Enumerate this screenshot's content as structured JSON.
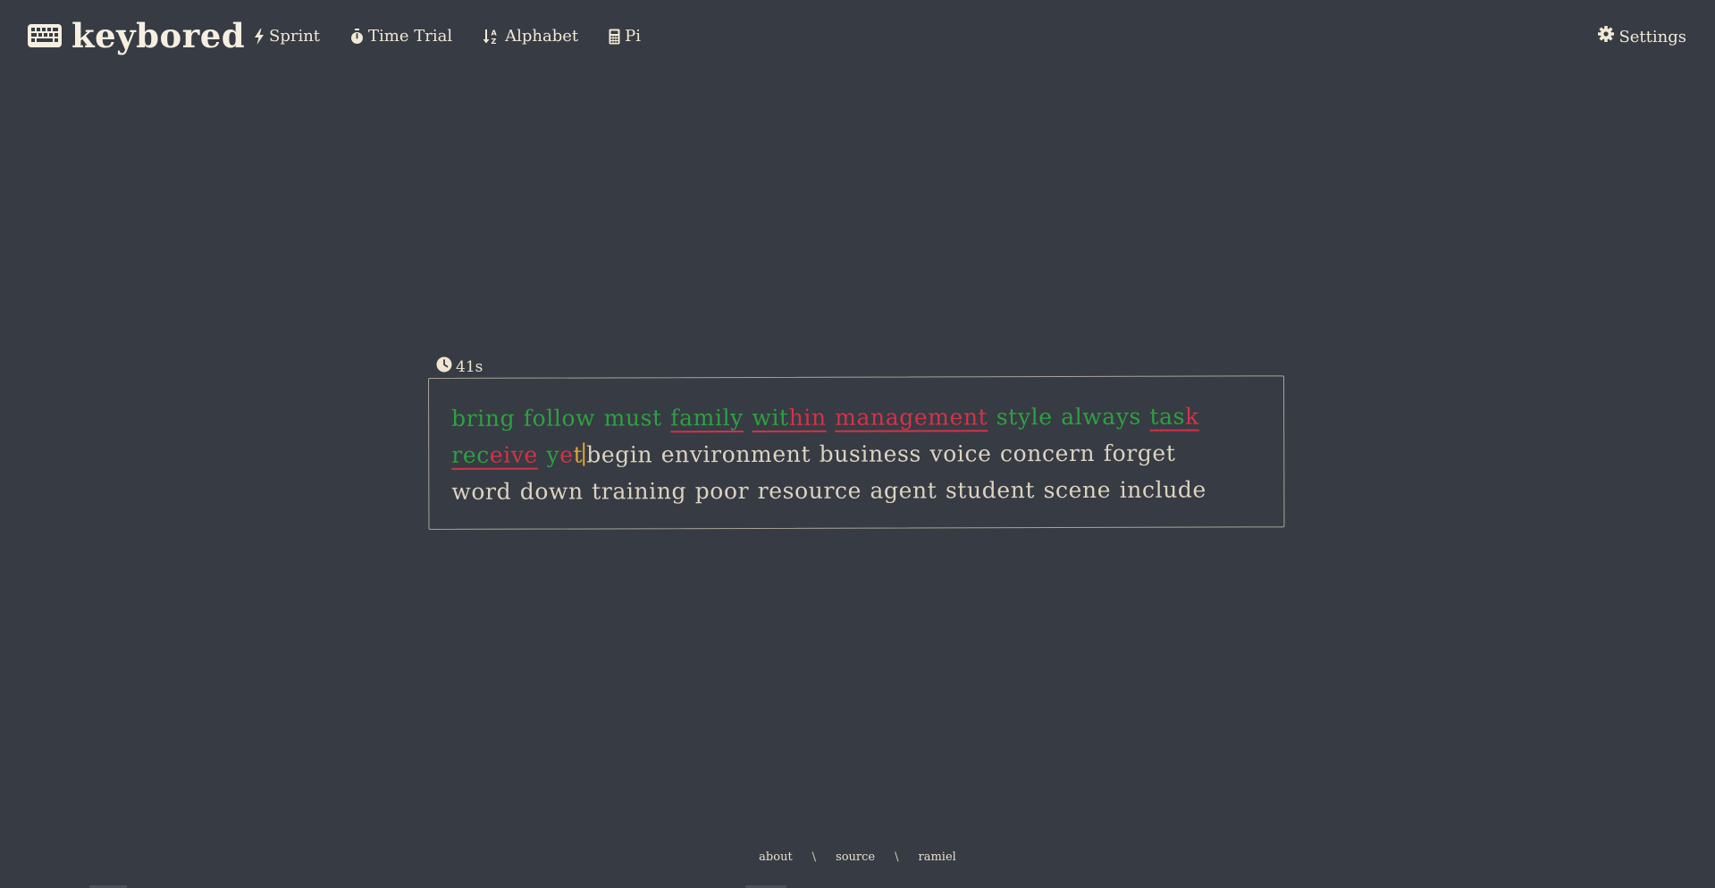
{
  "brand": {
    "name": "keybored",
    "icon": "keyboard-icon"
  },
  "nav": {
    "items": [
      {
        "label": "Sprint",
        "icon": "bolt-icon"
      },
      {
        "label": "Time Trial",
        "icon": "stopwatch-icon"
      },
      {
        "label": "Alphabet",
        "icon": "sort-alpha-down-icon"
      },
      {
        "label": "Pi",
        "icon": "calculator-icon"
      }
    ],
    "settings_label": "Settings",
    "settings_icon": "gear-icon"
  },
  "timer": {
    "value": "41s",
    "icon": "clock-icon"
  },
  "typing": {
    "lines": [
      {
        "words": [
          {
            "text": "bring",
            "state": "correct"
          },
          {
            "text": "follow",
            "state": "correct"
          },
          {
            "text": "must",
            "state": "correct"
          },
          {
            "segments": [
              {
                "text": "f",
                "state": "correct"
              },
              {
                "text": "amily",
                "state": "correct"
              }
            ],
            "underline": "red",
            "state": "mixed"
          },
          {
            "segments": [
              {
                "text": "wit",
                "state": "correct"
              },
              {
                "text": "hin",
                "state": "incorrect"
              }
            ],
            "underline": "red",
            "state": "mixed"
          },
          {
            "text": "management",
            "state": "incorrect",
            "underline": "red"
          },
          {
            "text": "style",
            "state": "correct"
          },
          {
            "text": "always",
            "state": "correct"
          },
          {
            "segments": [
              {
                "text": "tas",
                "state": "correct"
              },
              {
                "text": "k",
                "state": "incorrect"
              }
            ],
            "underline": "red",
            "state": "mixed"
          }
        ]
      },
      {
        "words": [
          {
            "segments": [
              {
                "text": "rec",
                "state": "correct"
              },
              {
                "text": "eive",
                "state": "incorrect"
              }
            ],
            "underline": "red",
            "state": "mixed"
          },
          {
            "segments": [
              {
                "text": "y",
                "state": "correct"
              },
              {
                "text": "e",
                "state": "incorrect"
              },
              {
                "text": "t",
                "state": "current"
              }
            ],
            "state": "active"
          },
          {
            "text": "begin",
            "state": "untyped"
          },
          {
            "text": "environment",
            "state": "untyped"
          },
          {
            "text": "business",
            "state": "untyped"
          },
          {
            "text": "voice",
            "state": "untyped"
          },
          {
            "text": "concern",
            "state": "untyped"
          },
          {
            "text": "forget",
            "state": "untyped"
          }
        ]
      },
      {
        "words": [
          {
            "text": "word",
            "state": "untyped"
          },
          {
            "text": "down",
            "state": "untyped"
          },
          {
            "text": "training",
            "state": "untyped"
          },
          {
            "text": "poor",
            "state": "untyped"
          },
          {
            "text": "resource",
            "state": "untyped"
          },
          {
            "text": "agent",
            "state": "untyped"
          },
          {
            "text": "student",
            "state": "untyped"
          },
          {
            "text": "scene",
            "state": "untyped"
          },
          {
            "text": "include",
            "state": "untyped"
          }
        ]
      }
    ],
    "colors": {
      "correct": "#2ea043",
      "incorrect": "#d33348",
      "untyped": "#dcd3c0",
      "cursor": "#e3a72f"
    }
  },
  "footer": {
    "links": [
      "about",
      "source",
      "ramiel"
    ],
    "separator": "\\"
  },
  "colors": {
    "background": "#373b43",
    "text": "#efe6d2",
    "border": "#a8a597"
  }
}
